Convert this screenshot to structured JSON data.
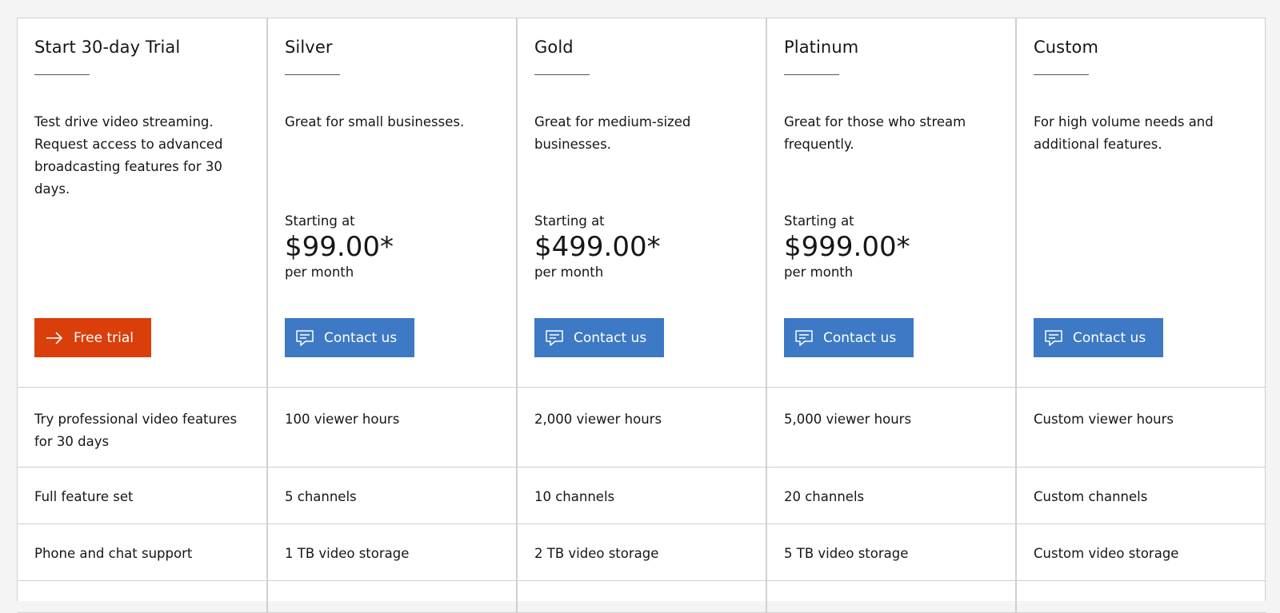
{
  "plans": [
    {
      "title": "Start 30-day Trial",
      "description": "Test drive video streaming. Request access to advanced broadcasting features for 30 days.",
      "cta_label": "Free trial",
      "cta_icon": "arrow-right-icon",
      "features": [
        "Try professional video features for 30 days",
        "Full feature set",
        "Phone and chat support"
      ]
    },
    {
      "title": "Silver",
      "description": "Great for small businesses.",
      "price_prefix": "Starting at",
      "price": "$99.00*",
      "price_suffix": "per month",
      "cta_label": "Contact us",
      "cta_icon": "chat-icon",
      "features": [
        "100 viewer hours",
        "5 channels",
        "1 TB video storage"
      ]
    },
    {
      "title": "Gold",
      "description": "Great for medium-sized businesses.",
      "price_prefix": "Starting at",
      "price": "$499.00*",
      "price_suffix": "per month",
      "cta_label": "Contact us",
      "cta_icon": "chat-icon",
      "features": [
        "2,000 viewer hours",
        "10 channels",
        "2 TB video storage"
      ]
    },
    {
      "title": "Platinum",
      "description": "Great for those who stream frequently.",
      "price_prefix": "Starting at",
      "price": "$999.00*",
      "price_suffix": "per month",
      "cta_label": "Contact us",
      "cta_icon": "chat-icon",
      "features": [
        "5,000 viewer hours",
        "20 channels",
        "5 TB video storage"
      ]
    },
    {
      "title": "Custom",
      "description": "For high volume needs and additional features.",
      "cta_label": "Contact us",
      "cta_icon": "chat-icon",
      "features": [
        "Custom viewer hours",
        "Custom channels",
        "Custom video storage"
      ]
    }
  ],
  "colors": {
    "trial_button": "#da3e0b",
    "contact_button": "#3d79c4",
    "border": "#d0d0d0",
    "page_background": "#f4f4f4"
  }
}
